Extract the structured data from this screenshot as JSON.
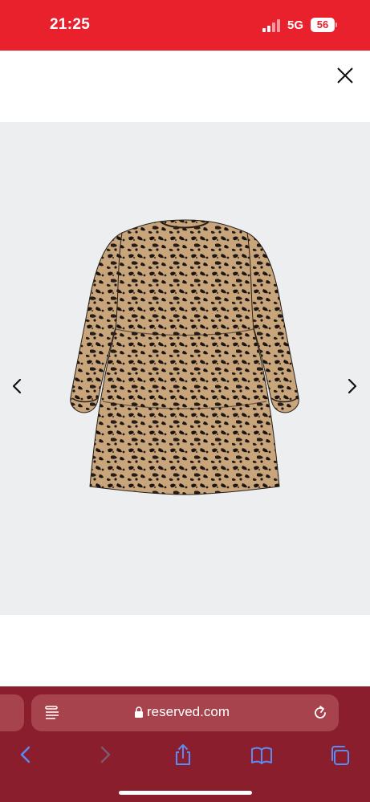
{
  "status_bar": {
    "time": "21:25",
    "network": "5G",
    "battery": "56",
    "icons": [
      "signal-icon",
      "battery-icon"
    ]
  },
  "viewer": {
    "close_icon": "close-icon",
    "prev_icon": "chevron-left-icon",
    "next_icon": "chevron-right-icon",
    "product_image": "leopard-print-tiered-dress"
  },
  "browser": {
    "url": "reserved.com",
    "icons": [
      "reader-icon",
      "lock-icon",
      "reload-icon"
    ],
    "toolbar": [
      "back-icon",
      "forward-icon",
      "share-icon",
      "bookmarks-icon",
      "tabs-icon"
    ]
  },
  "colors": {
    "status_bar": "#e8212c",
    "browser_bar": "#8b1e2c",
    "url_field": "#a7434d",
    "image_bg": "#eceef0",
    "toolbar_icon": "#5b8cf5"
  }
}
